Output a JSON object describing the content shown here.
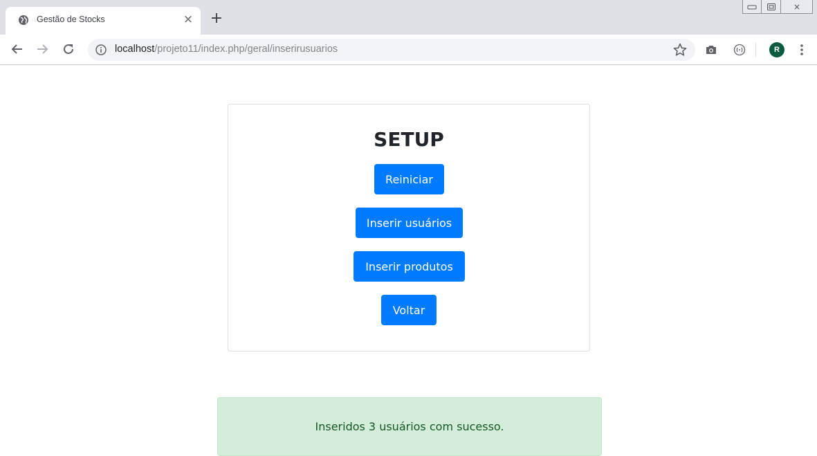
{
  "browser": {
    "tab": {
      "title": "Gestão de Stocks",
      "close_glyph": "×",
      "favicon": "globe-icon"
    },
    "new_tab_glyph": "+",
    "address": {
      "host": "localhost",
      "path": "/projeto11/index.php/geral/inserirusuarios"
    },
    "profile_initial": "R",
    "icons": [
      "back-arrow-icon",
      "forward-arrow-icon",
      "reload-icon",
      "info-icon",
      "bookmark-star-icon",
      "camera-icon",
      "extension-icon",
      "menu-dots-icon"
    ]
  },
  "setup": {
    "title": "SETUP",
    "buttons": {
      "reiniciar": "Reiniciar",
      "inserir_usuarios": "Inserir usuários",
      "inserir_produtos": "Inserir produtos",
      "voltar": "Voltar"
    }
  },
  "alert": {
    "message": "Inseridos 3 usuários com sucesso."
  },
  "colors": {
    "primary": "#007bff",
    "success_bg": "#d4edda",
    "success_text": "#155724",
    "avatar": "#0d5b3f"
  }
}
